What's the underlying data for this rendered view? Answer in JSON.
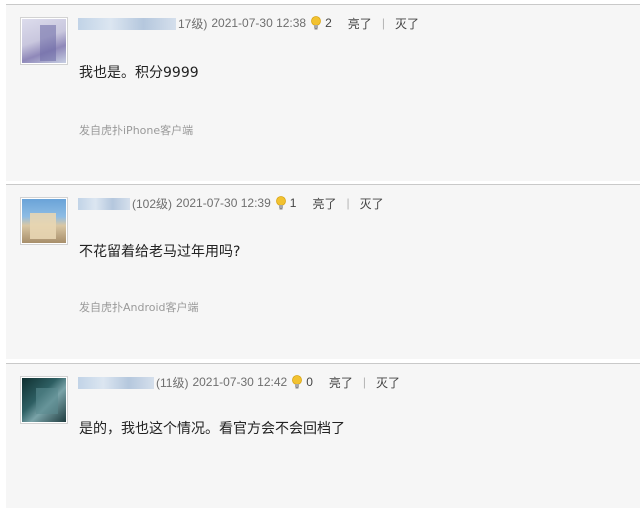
{
  "replies": [
    {
      "user_suffix": "17级)",
      "time": "2021-07-30 12:38",
      "light_count": "2",
      "light_label": "亮了",
      "separator": "|",
      "dim_label": "灭了",
      "content": "我也是。积分9999",
      "device": "发自虎扑iPhone客户端"
    },
    {
      "user_suffix": "(102级)",
      "time": "2021-07-30 12:39",
      "light_count": "1",
      "light_label": "亮了",
      "separator": "|",
      "dim_label": "灭了",
      "content": "不花留着给老马过年用吗?",
      "device": "发自虎扑Android客户端"
    },
    {
      "user_suffix": "(11级)",
      "time": "2021-07-30 12:42",
      "light_count": "0",
      "light_label": "亮了",
      "separator": "|",
      "dim_label": "灭了",
      "content": "是的，我也这个情况。看官方会不会回档了",
      "device": ""
    }
  ],
  "colors": {
    "username": "#1f5d99",
    "meta": "#6f6f6f",
    "background": "#f6f6f6",
    "bulb": "#f2c230"
  },
  "icons": {
    "light": "lightbulb-icon"
  }
}
